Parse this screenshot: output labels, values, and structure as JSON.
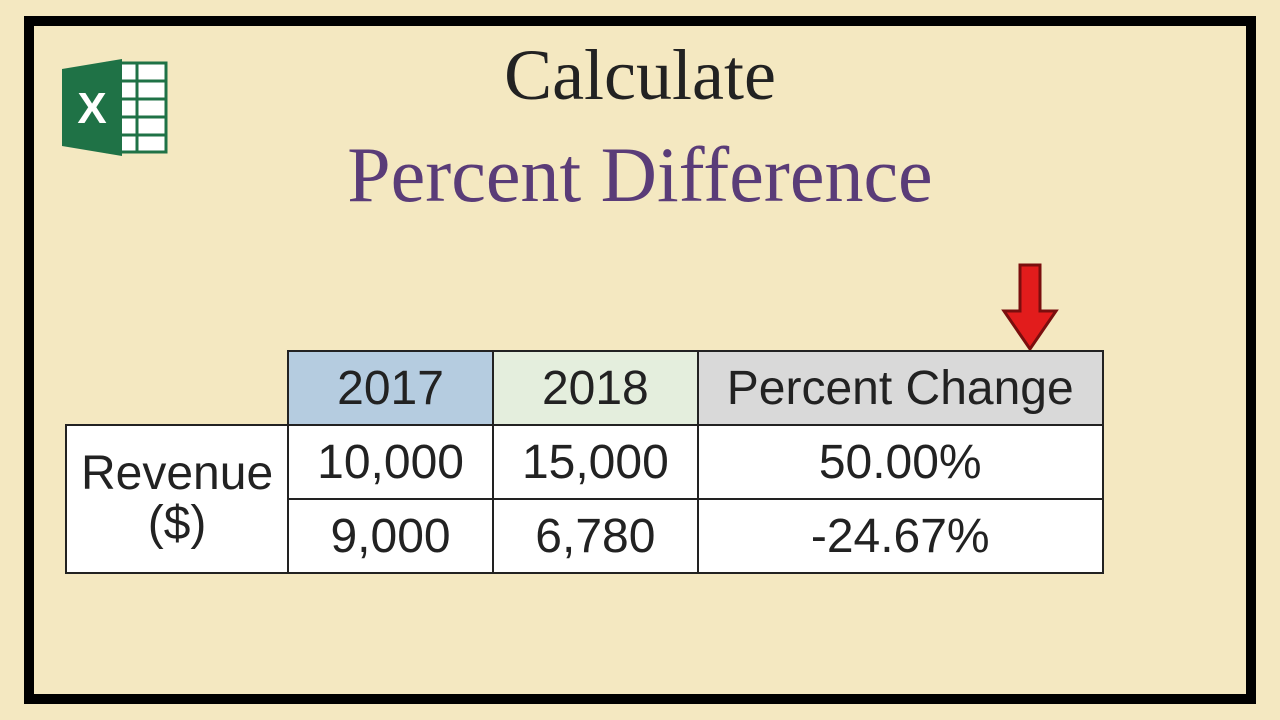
{
  "title": {
    "line1": "Calculate",
    "line2": "Percent Difference"
  },
  "icon": {
    "letter": "X"
  },
  "table": {
    "row_label_top": "Revenue",
    "row_label_bottom": "($)",
    "headers": {
      "y2017": "2017",
      "y2018": "2018",
      "pct": "Percent Change"
    },
    "rows": [
      {
        "y2017": "10,000",
        "y2018": "15,000",
        "pct": "50.00%"
      },
      {
        "y2017": "9,000",
        "y2018": "6,780",
        "pct": "-24.67%"
      }
    ]
  },
  "chart_data": {
    "type": "table",
    "title": "Calculate Percent Difference",
    "row_label": "Revenue ($)",
    "columns": [
      "2017",
      "2018",
      "Percent Change"
    ],
    "rows": [
      {
        "2017": 10000,
        "2018": 15000,
        "Percent Change": 50.0
      },
      {
        "2017": 9000,
        "2018": 6780,
        "Percent Change": -24.67
      }
    ]
  }
}
